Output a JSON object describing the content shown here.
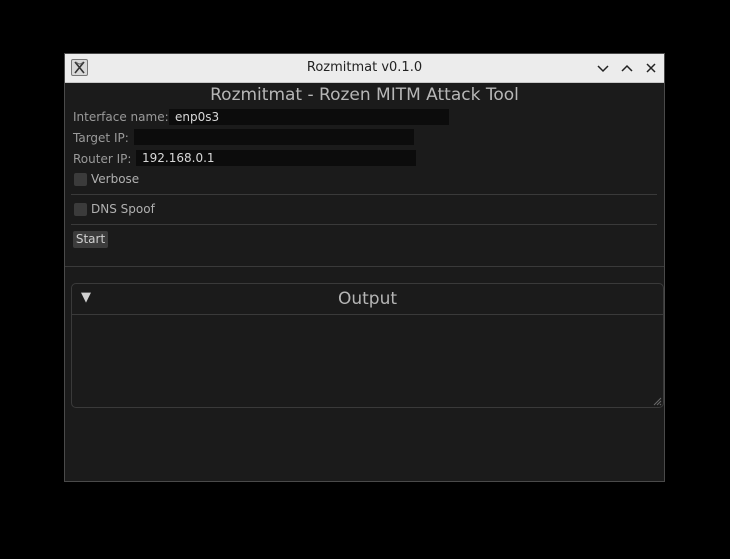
{
  "window": {
    "title": "Rozmitmat v0.1.0",
    "buttons": [
      "minimize",
      "maximize",
      "close"
    ]
  },
  "panel": {
    "title": "Rozmitmat - Rozen MITM Attack Tool"
  },
  "form": {
    "interface_label": "Interface name:",
    "interface_value": "enp0s3",
    "target_label": "Target IP:",
    "target_value": "",
    "router_label": "Router IP:",
    "router_value": "192.168.0.1",
    "verbose_label": "Verbose",
    "verbose_checked": false,
    "dns_label": "DNS Spoof",
    "dns_checked": false,
    "start_label": "Start"
  },
  "output": {
    "title": "Output",
    "collapse_icon": "▼",
    "text": ""
  },
  "colors": {
    "background": "#1b1b1b",
    "titlebar": "#ececec",
    "field": "#0c0c0c"
  }
}
